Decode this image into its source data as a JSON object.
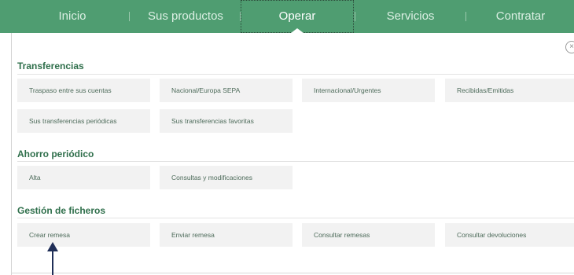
{
  "nav": {
    "items": [
      "Inicio",
      "Sus productos",
      "Operar",
      "Servicios",
      "Contratar"
    ],
    "active": "Operar"
  },
  "close_symbol": "×",
  "sections": [
    {
      "title": "Transferencias",
      "tiles": [
        "Traspaso entre sus cuentas",
        "Nacional/Europa SEPA",
        "Internacional/Urgentes",
        "Recibidas/Emitidas",
        "Sus transferencias periódicas",
        "Sus transferencias favoritas"
      ]
    },
    {
      "title": "Ahorro periódico",
      "tiles": [
        "Alta",
        "Consultas y modificaciones"
      ]
    },
    {
      "title": "Gestión de ficheros",
      "tiles": [
        "Crear remesa",
        "Enviar remesa",
        "Consultar remesas",
        "Consultar devoluciones"
      ]
    }
  ],
  "colors": {
    "nav_background": "#4f9d71",
    "section_title": "#2f6f4b",
    "tile_background": "#f2f2f2",
    "annotation_arrow": "#1f2e57"
  },
  "icons": {
    "close": "close-icon",
    "annotation": "up-arrow-annotation"
  }
}
